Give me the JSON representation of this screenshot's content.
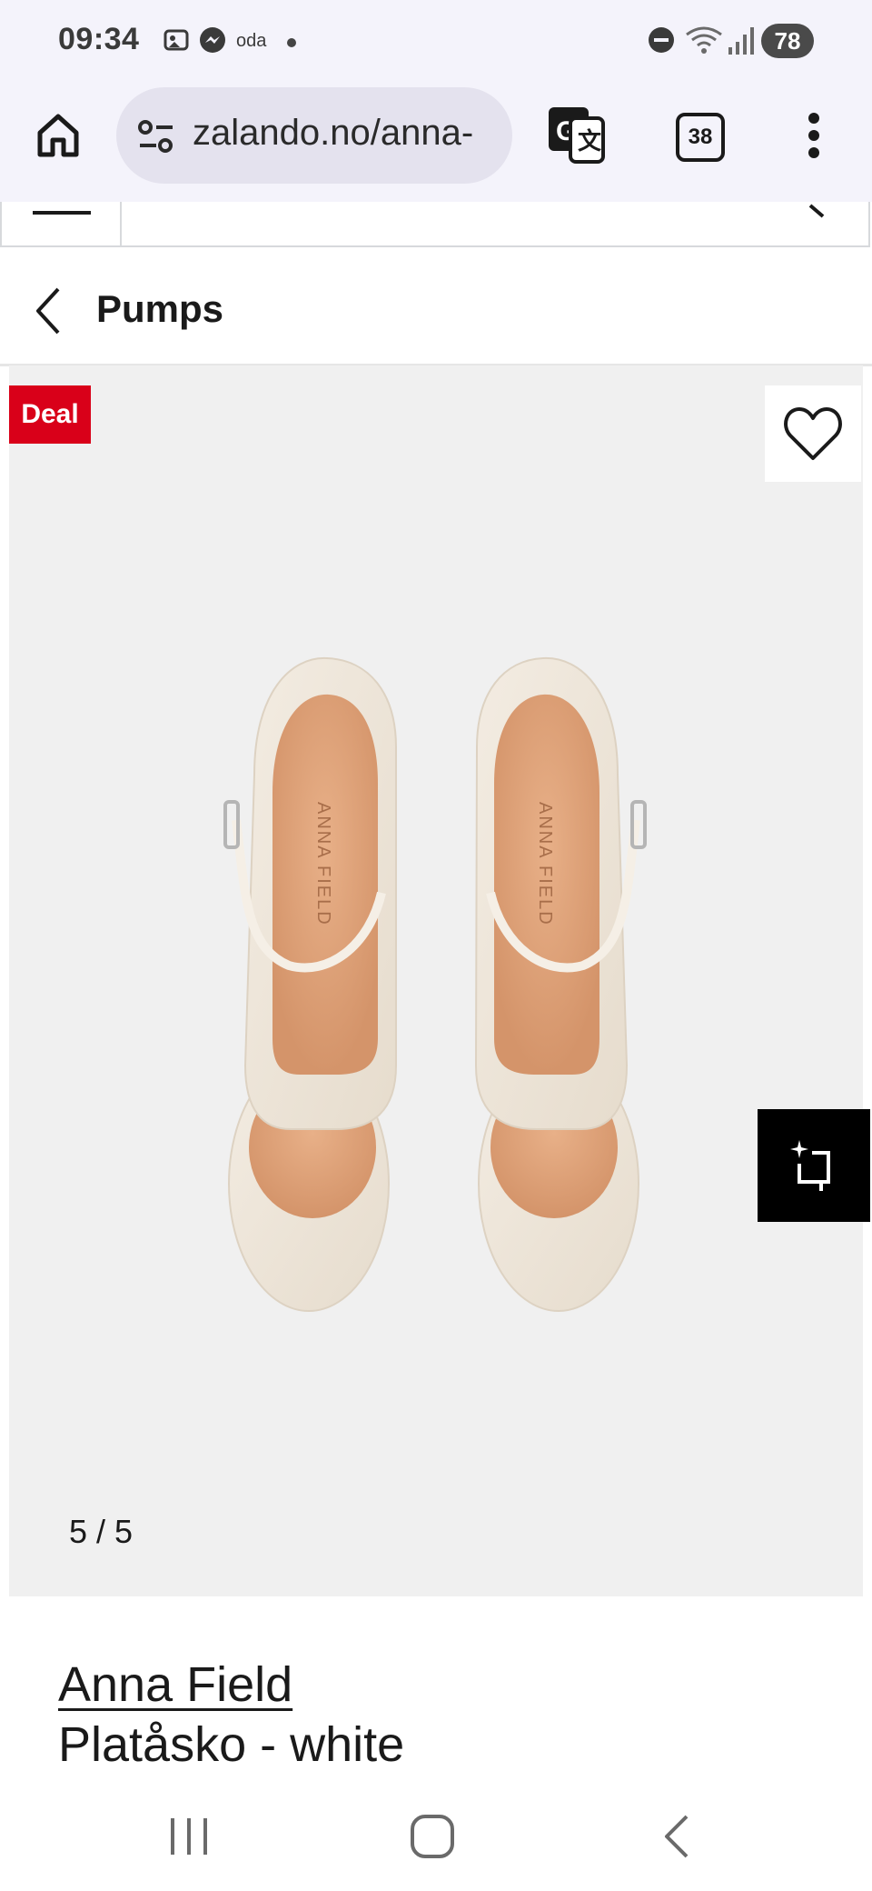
{
  "status_bar": {
    "time": "09:34",
    "notification_label": "oda",
    "battery": "78",
    "icons": [
      "screenshot-icon",
      "messenger-icon",
      "dnd-icon",
      "wifi-icon",
      "signal-icon"
    ]
  },
  "browser": {
    "url": "zalando.no/anna-",
    "tab_count": "38",
    "icons": [
      "home-icon",
      "site-settings-icon",
      "translate-icon",
      "more-vert-icon"
    ]
  },
  "category_header": {
    "title": "Pumps"
  },
  "gallery": {
    "badge": "Deal",
    "counter": "5 / 5",
    "icons": [
      "heart-icon",
      "ai-crop-icon"
    ],
    "colors": {
      "badge": "#d90019",
      "background": "#f0f0f0"
    }
  },
  "product": {
    "brand": "Anna Field",
    "name": "Platåsko - white",
    "image_text": "ANNA FIELD"
  }
}
